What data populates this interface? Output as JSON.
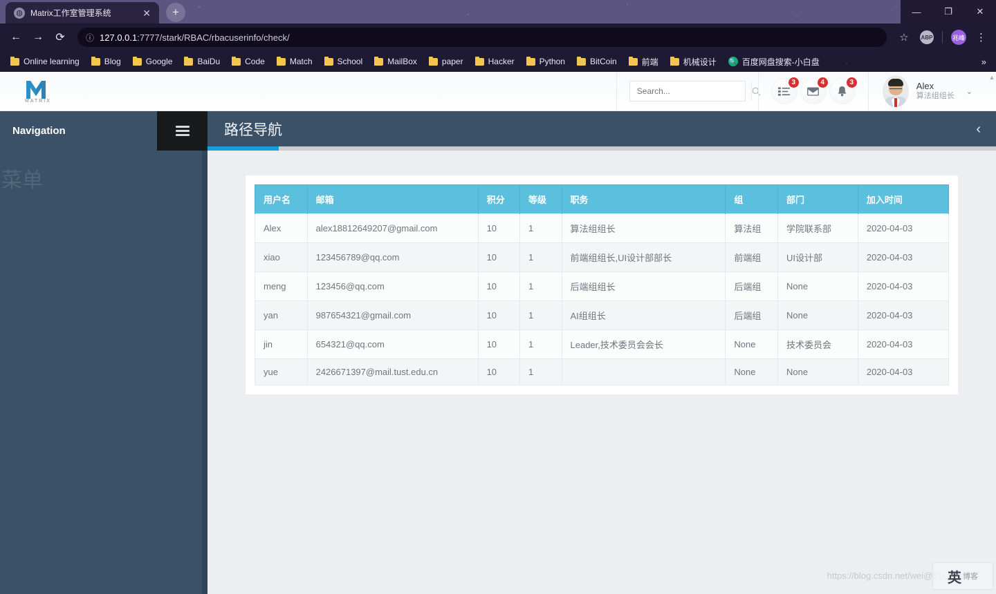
{
  "browser": {
    "tab": {
      "title": "Matrix工作室管理系统",
      "favicon": "globe-icon",
      "close": "✕"
    },
    "new_tab": "+",
    "window_controls": {
      "minimize": "—",
      "maximize": "❐",
      "close": "✕"
    },
    "nav": {
      "back": "←",
      "forward": "→",
      "reload": "⟳"
    },
    "omnibox": {
      "info_icon": "ⓘ",
      "host": "127.0.0.1",
      "path": ":7777/stark/RBAC/rbacuserinfo/check/",
      "star": "☆"
    },
    "extensions": {
      "abp": "ABP",
      "profile": "兆峰",
      "menu": "⋮"
    },
    "bookmarks": [
      {
        "label": "Online learning",
        "icon": "folder-icon"
      },
      {
        "label": "Blog",
        "icon": "folder-icon"
      },
      {
        "label": "Google",
        "icon": "folder-icon"
      },
      {
        "label": "BaiDu",
        "icon": "folder-icon"
      },
      {
        "label": "Code",
        "icon": "folder-icon"
      },
      {
        "label": "Match",
        "icon": "folder-icon"
      },
      {
        "label": "School",
        "icon": "folder-icon"
      },
      {
        "label": "MailBox",
        "icon": "folder-icon"
      },
      {
        "label": "paper",
        "icon": "folder-icon"
      },
      {
        "label": "Hacker",
        "icon": "folder-icon"
      },
      {
        "label": "Python",
        "icon": "folder-icon"
      },
      {
        "label": "BitCoin",
        "icon": "folder-icon"
      },
      {
        "label": "前端",
        "icon": "folder-icon"
      },
      {
        "label": "机械设计",
        "icon": "folder-icon"
      },
      {
        "label": "百度网盘搜索-小白盘",
        "icon": "search-green-icon"
      }
    ],
    "bookmarks_overflow": "»"
  },
  "app": {
    "brand": {
      "logo": "matrix-m-logo",
      "text": "MATRIX"
    },
    "search": {
      "placeholder": "Search...",
      "value": "",
      "icon": "search-icon"
    },
    "header_icons": [
      {
        "name": "tasks-icon",
        "glyph": "☰",
        "badge": "3"
      },
      {
        "name": "envelope-icon",
        "glyph": "✉",
        "badge": "4"
      },
      {
        "name": "bell-icon",
        "glyph": "🔔",
        "badge": "3"
      }
    ],
    "user": {
      "name": "Alex",
      "role": "算法组组长",
      "caret": "⌄",
      "avatar": "user-photo"
    },
    "sidebar": {
      "title": "Navigation",
      "ghost_label": "菜单"
    },
    "hamburger": "hamburger-icon",
    "page_title": "路径导航",
    "collapse": "‹",
    "progress_percent": 9
  },
  "table": {
    "columns": [
      "用户名",
      "邮箱",
      "积分",
      "等级",
      "职务",
      "组",
      "部门",
      "加入时间"
    ],
    "rows": [
      {
        "username": "Alex",
        "email": "alex18812649207@gmail.com",
        "points": "10",
        "level": "1",
        "position": "算法组组长",
        "group": "算法组",
        "dept": "学院联系部",
        "joined": "2020-04-03"
      },
      {
        "username": "xiao",
        "email": "123456789@qq.com",
        "points": "10",
        "level": "1",
        "position": "前端组组长,UI设计部部长",
        "group": "前端组",
        "dept": "UI设计部",
        "joined": "2020-04-03"
      },
      {
        "username": "meng",
        "email": "123456@qq.com",
        "points": "10",
        "level": "1",
        "position": "后端组组长",
        "group": "后端组",
        "dept": "None",
        "joined": "2020-04-03"
      },
      {
        "username": "yan",
        "email": "987654321@gmail.com",
        "points": "10",
        "level": "1",
        "position": "AI组组长",
        "group": "后端组",
        "dept": "None",
        "joined": "2020-04-03"
      },
      {
        "username": "jin",
        "email": "654321@qq.com",
        "points": "10",
        "level": "1",
        "position": "Leader,技术委员会会长",
        "group": "None",
        "dept": "技术委员会",
        "joined": "2020-04-03"
      },
      {
        "username": "yue",
        "email": "2426671397@mail.tust.edu.cn",
        "points": "10",
        "level": "1",
        "position": "",
        "group": "None",
        "dept": "None",
        "joined": "2020-04-03"
      }
    ]
  },
  "watermark": {
    "url": "https://blog.csdn.net/wei@51CTO博客",
    "badge_big": "英",
    "badge_small": "博客"
  },
  "colors": {
    "table_header": "#5bc0de",
    "sidebar": "#3b5168",
    "progress": "#1b9bd8",
    "badge": "#d63031",
    "browser_chrome": "#1f1a33"
  }
}
